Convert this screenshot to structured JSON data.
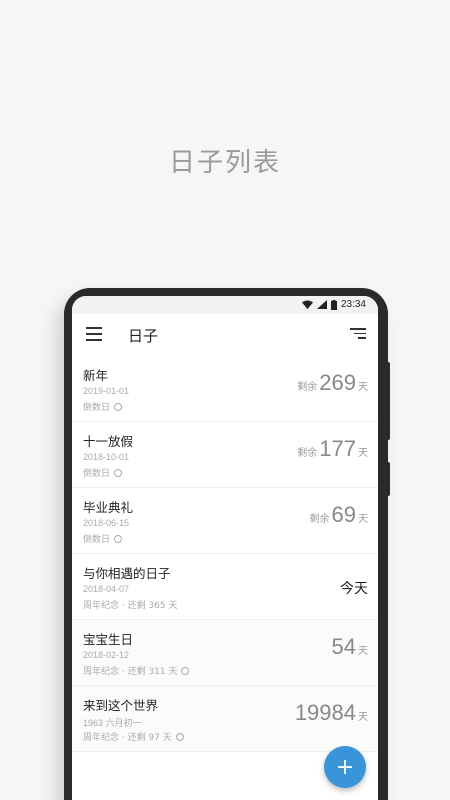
{
  "headline": "日子列表",
  "status": {
    "time": "23:34"
  },
  "appbar": {
    "title": "日子",
    "menu_icon": "menu-icon",
    "sort_icon": "sort-icon"
  },
  "items": [
    {
      "title": "新年",
      "date": "2019-01-01",
      "sub": "倒数日",
      "prefix": "剩余",
      "num": "269",
      "unit": "天"
    },
    {
      "title": "十一放假",
      "date": "2018-10-01",
      "sub": "倒数日",
      "prefix": "剩余",
      "num": "177",
      "unit": "天"
    },
    {
      "title": "毕业典礼",
      "date": "2018-06-15",
      "sub": "倒数日",
      "prefix": "剩余",
      "num": "69",
      "unit": "天"
    },
    {
      "title": "与你相遇的日子",
      "date": "2018-04-07",
      "sub": "周年纪念 · 还剩 365 天",
      "today": "今天"
    },
    {
      "title": "宝宝生日",
      "date": "2018-02-12",
      "sub": "周年纪念 · 还剩 311 天",
      "num": "54",
      "unit": "天"
    },
    {
      "title": "来到这个世界",
      "date": "1963 六月初一",
      "sub": "周年纪念 · 还剩 97 天",
      "num": "19984",
      "unit": "天"
    }
  ],
  "fab": {
    "label": "+"
  },
  "colors": {
    "accent": "#3a94d8",
    "bezel": "#2a2a2a"
  }
}
